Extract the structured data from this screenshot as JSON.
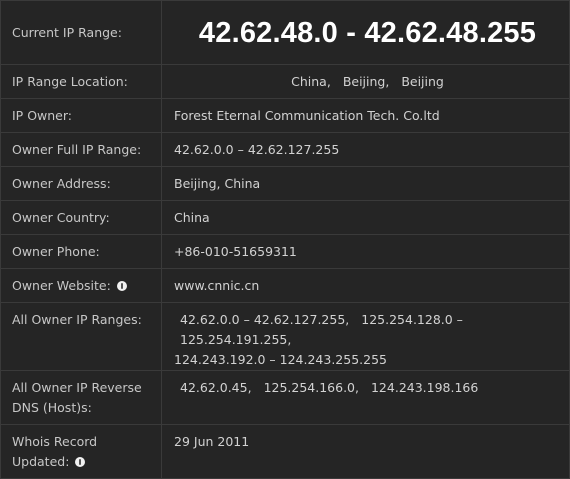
{
  "rows": {
    "current_range": {
      "label": "Current IP Range:",
      "value": "42.62.48.0 - 42.62.48.255"
    },
    "location": {
      "label": "IP Range Location:",
      "city_parts": [
        "China,",
        "Beijing,",
        "Beijing"
      ]
    },
    "owner": {
      "label": "IP Owner:",
      "value": "Forest Eternal Communication Tech. Co.ltd"
    },
    "full_range": {
      "label": "Owner Full IP Range:",
      "value": "42.62.0.0 – 42.62.127.255"
    },
    "address": {
      "label": "Owner Address:",
      "value": "Beijing, China"
    },
    "country": {
      "label": "Owner Country:",
      "value": "China"
    },
    "phone": {
      "label": "Owner Phone:",
      "value": "+86-010-51659311"
    },
    "website": {
      "label": "Owner Website:",
      "value": "www.cnnic.cn"
    },
    "all_ranges": {
      "label": "All Owner IP Ranges:",
      "line1": [
        "42.62.0.0 – 42.62.127.255,",
        "125.254.128.0 – 125.254.191.255,"
      ],
      "line2": "124.243.192.0 – 124.243.255.255"
    },
    "reverse_dns": {
      "label_line1": "All Owner IP Reverse",
      "label_line2": "DNS (Host)s:",
      "values": [
        "42.62.0.45,",
        "125.254.166.0,",
        "124.243.198.166"
      ]
    },
    "whois": {
      "label_line1": "Whois Record",
      "label_line2": "Updated:",
      "value": "29 Jun 2011"
    }
  },
  "icons": {
    "help": "info-circle-icon"
  }
}
